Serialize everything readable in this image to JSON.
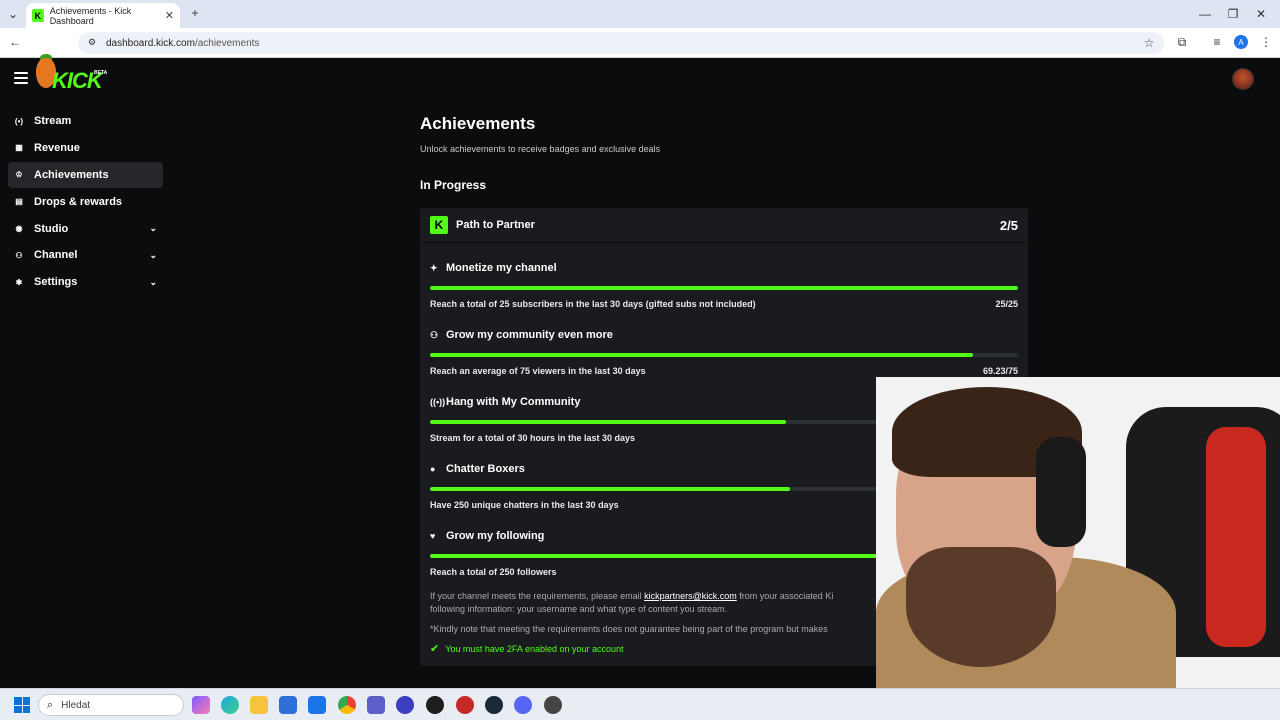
{
  "browser": {
    "tab_title": "Achievements - Kick Dashboard",
    "tab_favicon": "K",
    "url_host": "dashboard.kick.com",
    "url_path": "/achievements",
    "profile_initial": "A"
  },
  "header": {
    "logo_text": "KICK",
    "logo_badge": "BETA"
  },
  "sidebar": {
    "items": [
      {
        "label": "Stream",
        "icon": "broadcast-icon",
        "glyph": "(•)"
      },
      {
        "label": "Revenue",
        "icon": "chart-icon",
        "glyph": "▦"
      },
      {
        "label": "Achievements",
        "icon": "trophy-icon",
        "glyph": "♔",
        "active": true
      },
      {
        "label": "Drops & rewards",
        "icon": "gift-icon",
        "glyph": "▤"
      },
      {
        "label": "Studio",
        "icon": "studio-icon",
        "glyph": "◉",
        "chevron": "⌄"
      },
      {
        "label": "Channel",
        "icon": "channel-icon",
        "glyph": "⚇",
        "chevron": "⌄"
      },
      {
        "label": "Settings",
        "icon": "gear-icon",
        "glyph": "✱",
        "chevron": "⌄"
      }
    ]
  },
  "main": {
    "title": "Achievements",
    "subtitle": "Unlock achievements to receive badges and exclusive deals",
    "section_title": "In Progress",
    "card": {
      "title": "Path to Partner",
      "count": "2/5",
      "achievements": [
        {
          "title": "Monetize my channel",
          "icon": "sparkle-icon",
          "glyph": "✦",
          "desc": "Reach a total of 25 subscribers in the last 30 days (gifted subs not included)",
          "value": "25/25",
          "progress": 1.0
        },
        {
          "title": "Grow my community even more",
          "icon": "community-icon",
          "glyph": "⚇",
          "desc": "Reach an average of 75 viewers in the last 30 days",
          "value": "69.23/75",
          "progress": 0.923
        },
        {
          "title": "Hang with My Community",
          "icon": "broadcast-icon",
          "glyph": "((•))",
          "desc": "Stream for a total of 30 hours in the last 30 days",
          "value": "",
          "progress": 0.605
        },
        {
          "title": "Chatter Boxers",
          "icon": "chat-icon",
          "glyph": "●",
          "desc": "Have 250 unique chatters in the last 30 days",
          "value": "",
          "progress": 0.613
        },
        {
          "title": "Grow my following",
          "icon": "heart-icon",
          "glyph": "♥",
          "desc": "Reach a total of 250 followers",
          "value": "",
          "progress": 0.79
        }
      ],
      "note_pre": "If your channel meets the requirements, please email ",
      "note_email": "kickpartners@kick.com",
      "note_post": " from your associated Ki",
      "note_line2": "following information: your username and what type of content you stream.",
      "note_disclaimer": "*Kindly note that meeting the requirements does not guarantee being part of the program but makes",
      "tfa_text": "You must have 2FA enabled on your account"
    }
  },
  "taskbar": {
    "search_placeholder": "Hledat"
  },
  "colors": {
    "accent": "#53fc18",
    "background": "#0b0c0d",
    "card": "#191b1f"
  }
}
